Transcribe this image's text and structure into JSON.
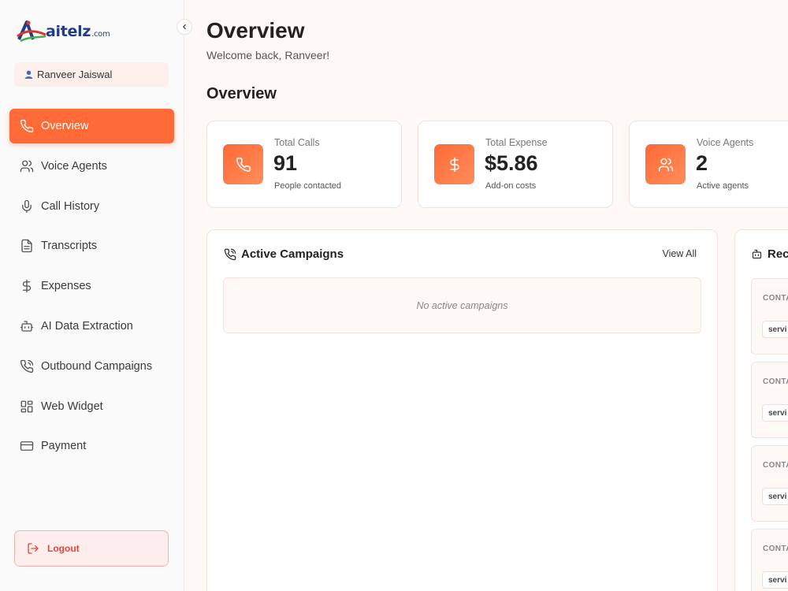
{
  "brand": {
    "name": "aitelz",
    "suffix": ".com",
    "colors": {
      "accent": "#ff6a36",
      "logo_blue": "#1f3d8a",
      "logo_green": "#3fb34f"
    }
  },
  "sidebar": {
    "user": {
      "name": "Ranveer Jaiswal",
      "icon": "user-icon"
    },
    "collapse_icon": "chevron-left-icon",
    "items": [
      {
        "label": "Overview",
        "icon": "phone-icon",
        "active": true
      },
      {
        "label": "Voice Agents",
        "icon": "users-icon",
        "active": false
      },
      {
        "label": "Call History",
        "icon": "microphone-icon",
        "active": false
      },
      {
        "label": "Transcripts",
        "icon": "document-icon",
        "active": false
      },
      {
        "label": "Expenses",
        "icon": "dollar-icon",
        "active": false
      },
      {
        "label": "AI Data Extraction",
        "icon": "bot-icon",
        "active": false
      },
      {
        "label": "Outbound Campaigns",
        "icon": "phone-outgoing-icon",
        "active": false
      },
      {
        "label": "Web Widget",
        "icon": "widget-icon",
        "active": false
      },
      {
        "label": "Payment",
        "icon": "credit-card-icon",
        "active": false
      }
    ],
    "logout_label": "Logout"
  },
  "header": {
    "title": "Overview",
    "welcome": "Welcome back, Ranveer!"
  },
  "overview_section": {
    "title": "Overview",
    "stats": [
      {
        "label": "Total Calls",
        "value": "91",
        "sub": "People contacted",
        "icon": "phone-icon"
      },
      {
        "label": "Total Expense",
        "value": "$5.86",
        "sub": "Add-on costs",
        "icon": "dollar-icon"
      },
      {
        "label": "Voice Agents",
        "value": "2",
        "sub": "Active agents",
        "icon": "users-icon"
      }
    ]
  },
  "campaigns_panel": {
    "title": "Active Campaigns",
    "view_all": "View All",
    "empty_text": "No active campaigns",
    "icon": "phone-outgoing-icon"
  },
  "recent_panel": {
    "title_visible": "Rec",
    "icon": "bot-icon",
    "cards": [
      {
        "label": "CONTA",
        "tag": "servi"
      },
      {
        "label": "CONTA",
        "tag": "servi"
      },
      {
        "label": "CONTA",
        "tag": "servi"
      },
      {
        "label": "CONTA",
        "tag": "servi"
      }
    ]
  }
}
